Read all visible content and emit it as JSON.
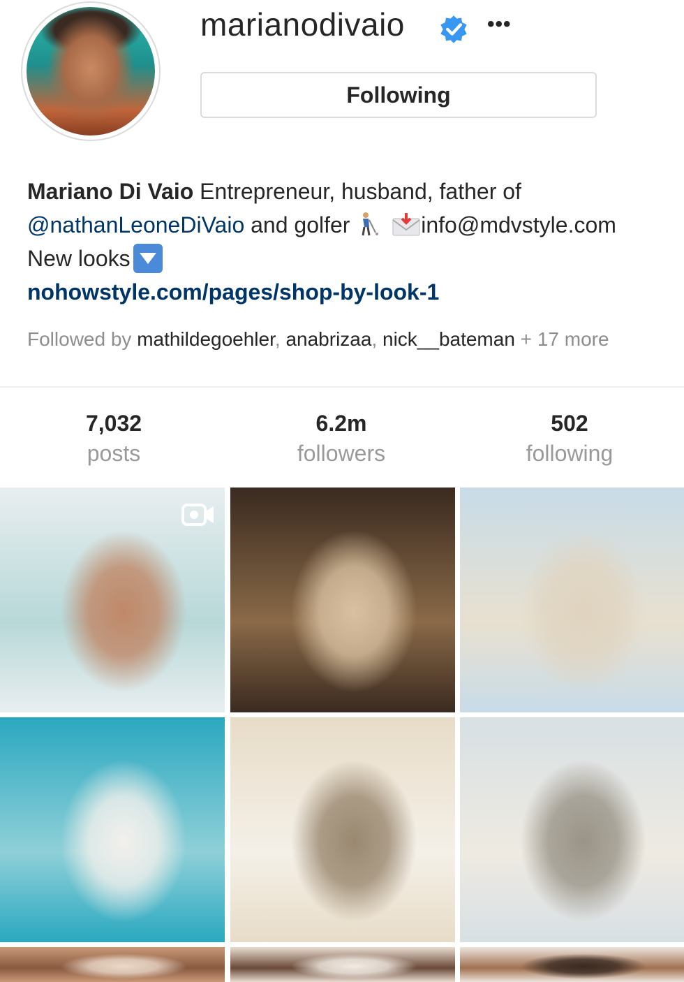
{
  "profile": {
    "username": "marianodivaio",
    "verified": true,
    "more_label": "•••",
    "follow_label": "Following"
  },
  "bio": {
    "name": "Mariano Di Vaio",
    "line1_text": " Entrepreneur, husband, father of",
    "mention": "@nathanLeoneDiVaio",
    "line2_text": " and golfer",
    "email": "info@mdvstyle.com",
    "line3_text": "New looks",
    "link": "nohowstyle.com/pages/shop-by-look-1"
  },
  "followed_by": {
    "prefix": "Followed by ",
    "users": [
      "mathildegoehler",
      "anabrizaa",
      "nick__bateman"
    ],
    "separator": ", ",
    "suffix": " + 17 more"
  },
  "stats": [
    {
      "value": "7,032",
      "label": "posts"
    },
    {
      "value": "6.2m",
      "label": "followers"
    },
    {
      "value": "502",
      "label": "following"
    }
  ],
  "grid": {
    "posts": [
      {
        "scene": "father kissing child in shallow sea",
        "is_video": true,
        "colors": [
          "#e8eef0",
          "#b8d8d8",
          "#c08868"
        ]
      },
      {
        "scene": "man carrying child on shoulders in restaurant",
        "is_video": false,
        "colors": [
          "#3a2a20",
          "#8a6a48",
          "#d8c0a0"
        ]
      },
      {
        "scene": "couple on beach at sunset",
        "is_video": false,
        "colors": [
          "#c8dce8",
          "#e8e0d0",
          "#e0d4c0"
        ]
      },
      {
        "scene": "father and son walking on tropical beach",
        "is_video": false,
        "colors": [
          "#2aa8c0",
          "#8fd0d8",
          "#f2f0ec"
        ]
      },
      {
        "scene": "man in bathrobe with toddler in sauna",
        "is_video": false,
        "colors": [
          "#e8dcc8",
          "#f4f0e8",
          "#9a8870"
        ]
      },
      {
        "scene": "man in white shirt walking on beach with waves",
        "is_video": false,
        "colors": [
          "#d8e0e4",
          "#eeeae2",
          "#9a9488"
        ]
      },
      {
        "scene": "man outdoors",
        "is_video": false,
        "colors": [
          "#c89878",
          "#8a5a40",
          "#ead8c8"
        ]
      },
      {
        "scene": "man among palm trees",
        "is_video": false,
        "colors": [
          "#e8dcd0",
          "#6a4a38",
          "#f2ece4"
        ]
      },
      {
        "scene": "man smiling outdoors",
        "is_video": false,
        "colors": [
          "#ece4dc",
          "#a07050",
          "#3a2a22"
        ]
      }
    ]
  },
  "colors": {
    "link": "#003569",
    "secondary_text": "#8e8e8e",
    "verified": "#3897f0",
    "border": "#dbdbdb"
  }
}
